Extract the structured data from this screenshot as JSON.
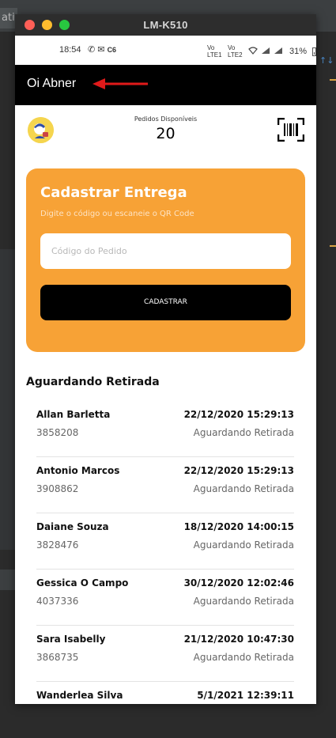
{
  "ide": {
    "tab_fragment": "atio"
  },
  "window": {
    "title": "LM-K510"
  },
  "status_bar": {
    "time": "18:54",
    "extra": "C6",
    "net1": "Vo LTE1",
    "net2": "Vo LTE2",
    "battery": "31%"
  },
  "app_bar": {
    "greeting": "Oi Abner"
  },
  "header": {
    "pedidos_label": "Pedidos Disponíveis",
    "pedidos_count": "20"
  },
  "form": {
    "title": "Cadastrar Entrega",
    "subtitle": "Digite o código ou escaneie o QR Code",
    "code_placeholder": "Código do Pedido",
    "submit_label": "CADASTRAR"
  },
  "section_title": "Aguardando Retirada",
  "deliveries": [
    {
      "name": "Allan Barletta",
      "date": "22/12/2020 15:29:13",
      "code": "3858208",
      "status": "Aguardando Retirada"
    },
    {
      "name": "Antonio Marcos",
      "date": "22/12/2020 15:29:13",
      "code": "3908862",
      "status": "Aguardando Retirada"
    },
    {
      "name": "Daiane Souza",
      "date": "18/12/2020 14:00:15",
      "code": "3828476",
      "status": "Aguardando Retirada"
    },
    {
      "name": "Gessica O Campo",
      "date": "30/12/2020 12:02:46",
      "code": "4037336",
      "status": "Aguardando Retirada"
    },
    {
      "name": "Sara Isabelly",
      "date": "21/12/2020 10:47:30",
      "code": "3868735",
      "status": "Aguardando Retirada"
    },
    {
      "name": "Wanderlea Silva",
      "date": "5/1/2021 12:39:11",
      "code": "",
      "status": ""
    }
  ],
  "colors": {
    "accent": "#f7a236",
    "appbar": "#000000",
    "arrow": "#e01a1a"
  }
}
